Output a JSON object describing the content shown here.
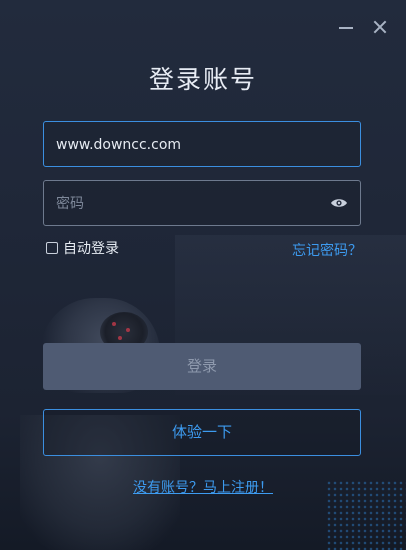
{
  "window": {
    "title": "登录账号",
    "controls": {
      "minimize_icon": "minimize-icon",
      "close_icon": "close-icon"
    }
  },
  "form": {
    "username_value": "www.downcc.com",
    "password_placeholder": "密码",
    "password_toggle_icon": "eye-icon",
    "remember_label": "自动登录",
    "remember_checked": false,
    "forgot_label": "忘记密码？"
  },
  "actions": {
    "login_label": "登录",
    "trial_label": "体验一下",
    "register_label": "没有账号？马上注册！"
  },
  "colors": {
    "accent": "#3b8fe0",
    "link": "#3d9bf0",
    "background": "#1f2738",
    "login_disabled": "#4f5b73"
  }
}
